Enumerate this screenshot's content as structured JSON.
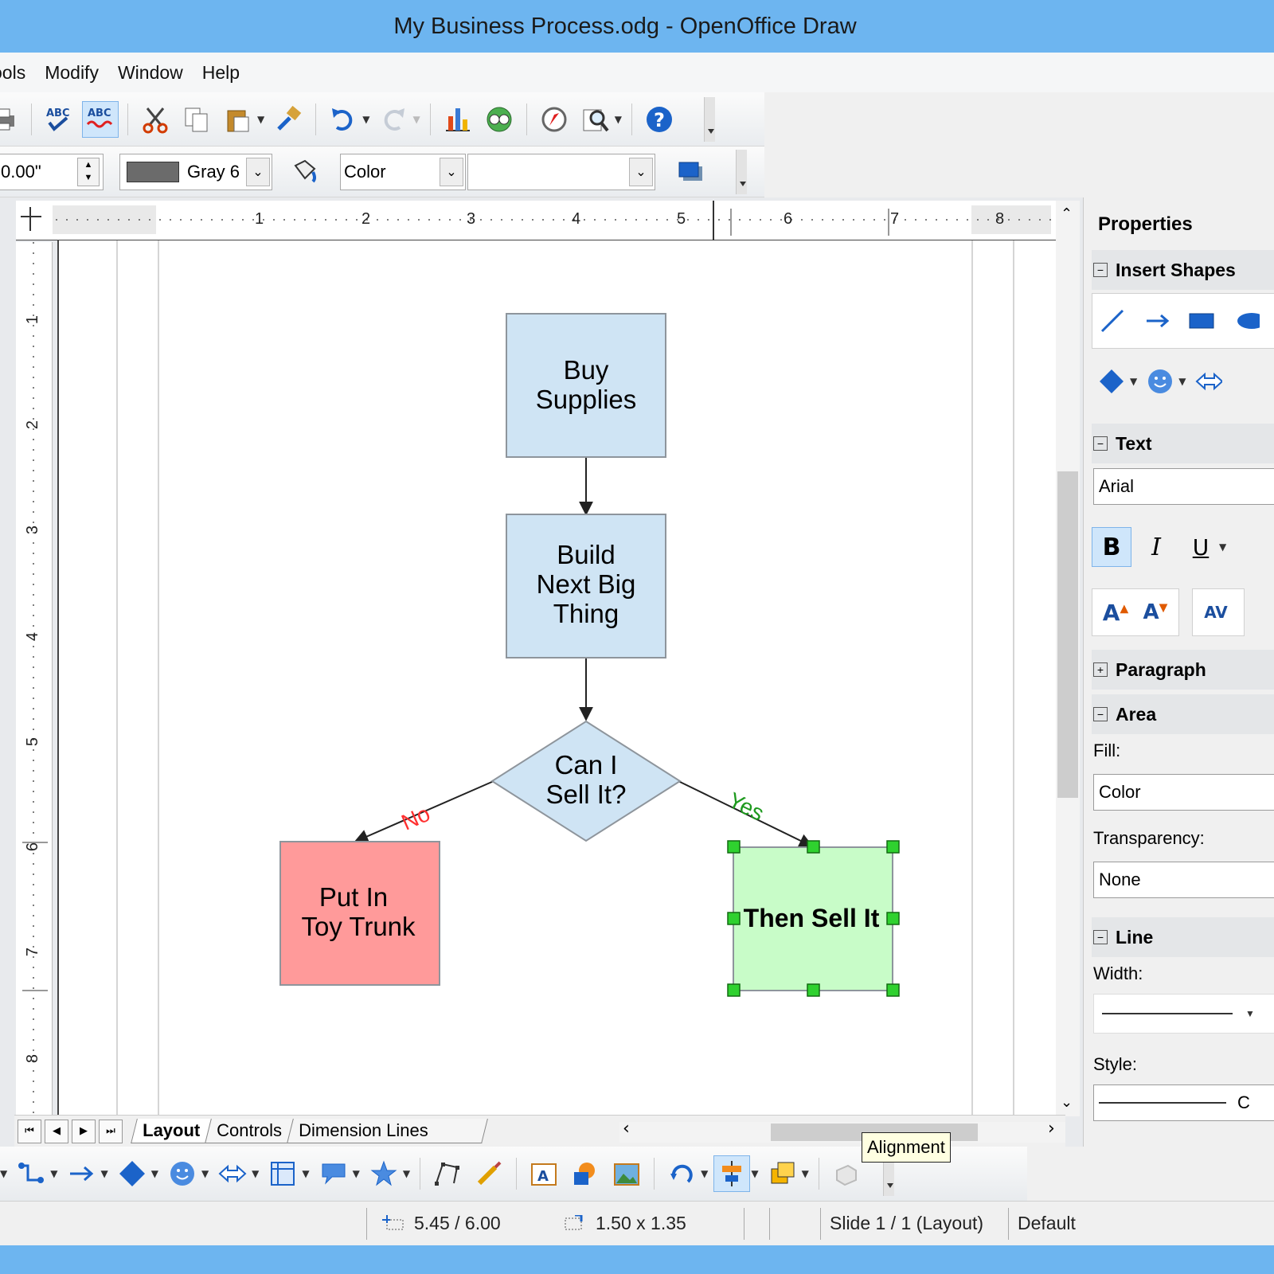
{
  "window": {
    "title": "My Business Process.odg - OpenOffice Draw"
  },
  "menu": [
    "ools",
    "Modify",
    "Window",
    "Help"
  ],
  "std_toolbar": {
    "icons": [
      "print-icon",
      "spellcheck-icon",
      "autospellcheck-icon",
      "cut-icon",
      "copy-icon",
      "paste-icon",
      "clone-formatting-icon",
      "undo-icon",
      "redo-icon",
      "chart-icon",
      "insert-image-icon",
      "navigator-icon",
      "zoom-icon",
      "help-icon"
    ]
  },
  "line_toolbar": {
    "width_value": "0.00\"",
    "line_color_name": "Gray 6",
    "line_color_hex": "#6b6b6b",
    "area_style": "Color",
    "area_color": ""
  },
  "ruler": {
    "h_labels": [
      "1",
      "2",
      "3",
      "4",
      "5",
      "6",
      "7",
      "8"
    ],
    "v_labels": [
      "1",
      "2",
      "3",
      "4",
      "5",
      "6",
      "7",
      "8"
    ]
  },
  "flowchart": {
    "nodes": {
      "buy": {
        "text": [
          "Buy",
          "Supplies"
        ],
        "fill": "#cfe4f4"
      },
      "build": {
        "text": [
          "Build",
          "Next Big",
          "Thing"
        ],
        "fill": "#cfe4f4"
      },
      "decision": {
        "text": [
          "Can I",
          "Sell It?"
        ],
        "fill": "#cfe4f4"
      },
      "trunk": {
        "text": [
          "Put In",
          "Toy Trunk"
        ],
        "fill": "#ff9a9a"
      },
      "sell": {
        "text": "Then Sell It",
        "fill": "#c8fcc8"
      }
    },
    "edge_labels": {
      "no": "No",
      "yes": "Yes"
    },
    "colors": {
      "no": "#ff3030",
      "yes": "#1f9a1f"
    }
  },
  "tabs": {
    "items": [
      "Layout",
      "Controls",
      "Dimension Lines"
    ],
    "active": 0
  },
  "tooltip": "Alignment",
  "sidebar": {
    "title": "Properties",
    "insert_shapes": "Insert Shapes",
    "text": {
      "title": "Text",
      "font": "Arial"
    },
    "paragraph": "Paragraph",
    "area": {
      "title": "Area",
      "fill_label": "Fill:",
      "fill_value": "Color",
      "transparency_label": "Transparency:",
      "transparency_value": "None"
    },
    "line": {
      "title": "Line",
      "width_label": "Width:",
      "style_label": "Style:",
      "style_value": "C"
    }
  },
  "draw_toolbar": {
    "icons": [
      "connector-icon",
      "arrow-line-icon",
      "basic-shapes-icon",
      "smiley-icon",
      "block-arrows-icon",
      "flowchart-icon",
      "callout-icon",
      "stars-icon",
      "points-icon",
      "glue-icon",
      "fontwork-icon",
      "shapes-icon",
      "image-icon",
      "rotate-icon",
      "alignment-icon",
      "arrange-icon",
      "extrusion-icon"
    ]
  },
  "status": {
    "position": "5.45 / 6.00",
    "size": "1.50 x 1.35",
    "slide": "Slide 1 / 1 (Layout)",
    "style": "Default"
  }
}
